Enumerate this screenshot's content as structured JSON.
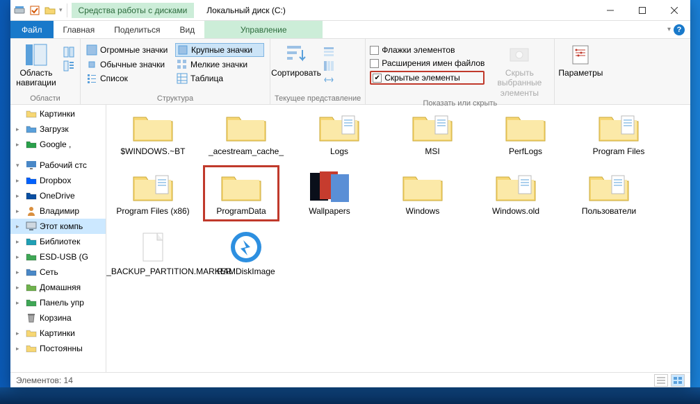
{
  "title": {
    "diskTab": "Средства работы с дисками",
    "text": "Локальный диск (C:)"
  },
  "tabs": {
    "file": "Файл",
    "home": "Главная",
    "share": "Поделиться",
    "view": "Вид",
    "manage": "Управление"
  },
  "ribbon": {
    "panes": {
      "label": "Области",
      "nav": "Область навигации"
    },
    "layout": {
      "label": "Структура",
      "huge": "Огромные значки",
      "large": "Крупные значки",
      "normal": "Обычные значки",
      "small": "Мелкие значки",
      "list": "Список",
      "table": "Таблица"
    },
    "current": {
      "label": "Текущее представление",
      "sort": "Сортировать"
    },
    "show": {
      "label": "Показать или скрыть",
      "flags": "Флажки элементов",
      "ext": "Расширения имен файлов",
      "hidden": "Скрытые элементы",
      "hideSel": "Скрыть выбранные элементы"
    },
    "options": "Параметры"
  },
  "help": {
    "chevron": "▾",
    "q": "?"
  },
  "sidebar": {
    "items": [
      {
        "label": "Картинки",
        "icon": "folder",
        "arrow": ""
      },
      {
        "label": "Загрузк",
        "icon": "download",
        "arrow": "▸"
      },
      {
        "label": "Google ,",
        "icon": "drive",
        "arrow": "▸"
      },
      {
        "label": "",
        "icon": "",
        "arrow": "",
        "spacer": true
      },
      {
        "label": "Рабочий стс",
        "icon": "desktop",
        "arrow": "▾",
        "bold": true
      },
      {
        "label": "Dropbox",
        "icon": "dropbox",
        "arrow": "▸"
      },
      {
        "label": "OneDrive",
        "icon": "onedrive",
        "arrow": "▸"
      },
      {
        "label": "Владимир",
        "icon": "user",
        "arrow": "▸"
      },
      {
        "label": "Этот компь",
        "icon": "pc",
        "arrow": "▸",
        "selected": true
      },
      {
        "label": "Библиотек",
        "icon": "libs",
        "arrow": "▸"
      },
      {
        "label": "ESD-USB (G",
        "icon": "usb",
        "arrow": "▸"
      },
      {
        "label": "Сеть",
        "icon": "network",
        "arrow": "▸"
      },
      {
        "label": "Домашняя",
        "icon": "homegroup",
        "arrow": "▸"
      },
      {
        "label": "Панель упр",
        "icon": "control",
        "arrow": "▸"
      },
      {
        "label": "Корзина",
        "icon": "bin",
        "arrow": ""
      },
      {
        "label": "Картинки",
        "icon": "folder",
        "arrow": "▸"
      },
      {
        "label": "Постоянны",
        "icon": "folder",
        "arrow": "▸"
      }
    ]
  },
  "folders": [
    {
      "name": "$WINDOWS.~BT",
      "type": "folder"
    },
    {
      "name": "_acestream_cache_",
      "type": "folder"
    },
    {
      "name": "Logs",
      "type": "folder-doc"
    },
    {
      "name": "MSI",
      "type": "folder-doc"
    },
    {
      "name": "PerfLogs",
      "type": "folder"
    },
    {
      "name": "Program Files",
      "type": "folder-doc"
    },
    {
      "name": "Program Files (x86)",
      "type": "folder-doc"
    },
    {
      "name": "ProgramData",
      "type": "folder",
      "highlight": true
    },
    {
      "name": "Wallpapers",
      "type": "wallpaper"
    },
    {
      "name": "Windows",
      "type": "folder"
    },
    {
      "name": "Windows.old",
      "type": "folder-doc"
    },
    {
      "name": "Пользователи",
      "type": "folder-doc"
    },
    {
      "name": "$WINRE_BACKUP_PARTITION.MARKER",
      "type": "file"
    },
    {
      "name": "RAMDiskImage",
      "type": "ram"
    }
  ],
  "status": {
    "count": "Элементов: 14"
  }
}
